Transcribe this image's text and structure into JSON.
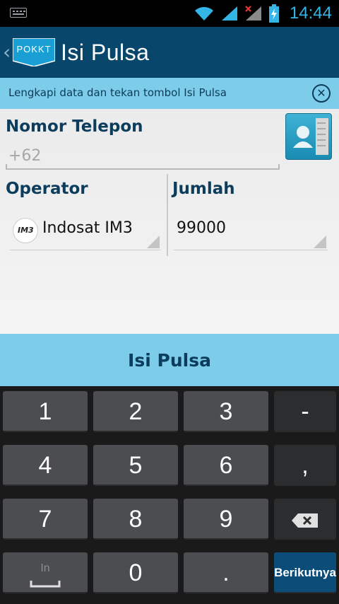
{
  "status_bar": {
    "time": "14:44"
  },
  "action_bar": {
    "logo_text": "POKKT",
    "title": "Isi Pulsa"
  },
  "banner": {
    "message": "Lengkapi data dan tekan tombol Isi Pulsa"
  },
  "form": {
    "phone_label": "Nomor Telepon",
    "phone_placeholder": "+62",
    "operator_label": "Operator",
    "operator_value": "Indosat IM3",
    "operator_logo_text": "IM3",
    "amount_label": "Jumlah",
    "amount_value": "99000"
  },
  "submit_label": "Isi Pulsa",
  "keyboard": {
    "row1": [
      "1",
      "2",
      "3",
      "-"
    ],
    "row2": [
      "4",
      "5",
      "6",
      ","
    ],
    "row3": [
      "7",
      "8",
      "9"
    ],
    "row4": [
      "In",
      "0",
      "."
    ],
    "next_label": "Berikutnya"
  },
  "colors": {
    "action_bar": "#08476b",
    "banner": "#7dcdea",
    "label_text": "#0c3d5c",
    "clock": "#33b5e5",
    "next_key": "#0b4d78"
  }
}
